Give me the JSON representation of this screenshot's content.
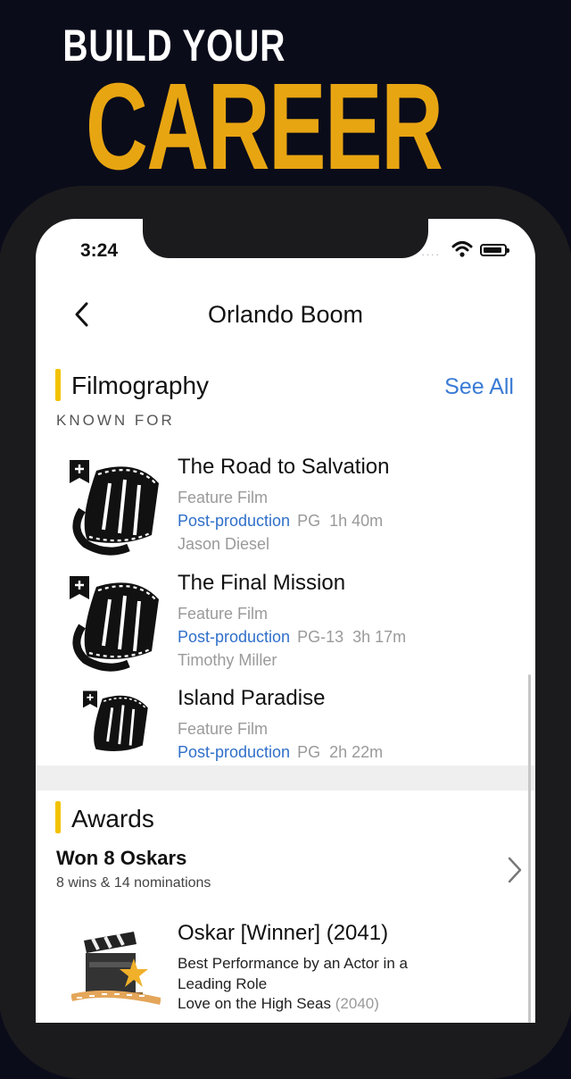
{
  "hero": {
    "subtitle": "BUILD YOUR",
    "title": "CAREER"
  },
  "status_bar": {
    "time": "3:24",
    "signal": "····"
  },
  "nav": {
    "title": "Orlando Boom"
  },
  "filmography": {
    "heading": "Filmography",
    "see_all": "See All",
    "subheading": "KNOWN FOR",
    "items": [
      {
        "title": "The Road to Salvation",
        "type": "Feature Film",
        "status": "Post-production",
        "rating": "PG",
        "runtime": "1h 40m",
        "director": "Jason Diesel"
      },
      {
        "title": "The Final Mission",
        "type": "Feature Film",
        "status": "Post-production",
        "rating": "PG-13",
        "runtime": "3h 17m",
        "director": "Timothy Miller"
      },
      {
        "title": "Island Paradise",
        "type": "Feature Film",
        "status": "Post-production",
        "rating": "PG",
        "runtime": "2h 22m",
        "director": ""
      }
    ]
  },
  "awards": {
    "heading": "Awards",
    "summary_title": "Won 8 Oskars",
    "summary_sub": "8 wins & 14 nominations",
    "items": [
      {
        "title": "Oskar [Winner] (2041)",
        "description": "Best Performance by an Actor in a Leading Role",
        "film": "Love on the High Seas",
        "film_year": "(2040)"
      }
    ]
  },
  "colors": {
    "accent_gold": "#e8a512",
    "section_bar": "#f2c200",
    "link_blue": "#3a7bd5",
    "status_blue": "#2f6fc9"
  },
  "icons": {
    "back": "chevron-left-icon",
    "watchlist": "bookmark-plus-icon",
    "film": "film-reel-icon",
    "award": "clapperboard-icon",
    "chevron": "chevron-right-icon"
  }
}
